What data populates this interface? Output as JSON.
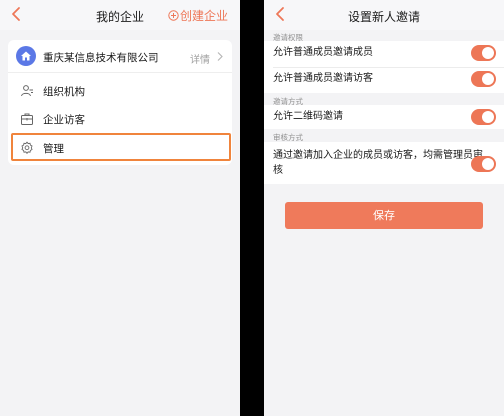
{
  "colors": {
    "accent": "#ee7758",
    "toggle_on": "#ed7656",
    "highlight_border": "#f0843c",
    "avatar": "#5b78e6"
  },
  "left_screen": {
    "nav": {
      "back_icon": "chevron-left-icon",
      "title": "我的企业",
      "action_icon": "plus-circle-icon",
      "action_label": "创建企业"
    },
    "company": {
      "avatar_icon": "home-icon",
      "name": "重庆某信息技术有限公司",
      "detail_label": "详情",
      "chevron_icon": "chevron-right-icon"
    },
    "menu": [
      {
        "icon": "org-structure-icon",
        "label": "组织机构"
      },
      {
        "icon": "visitor-briefcase-icon",
        "label": "企业访客"
      },
      {
        "icon": "gear-icon",
        "label": "管理",
        "highlighted": true
      }
    ]
  },
  "right_screen": {
    "nav": {
      "back_icon": "chevron-left-icon",
      "title": "设置新人邀请"
    },
    "sections": [
      {
        "header": "邀请权限",
        "items": [
          {
            "label": "允许普通成员邀请成员",
            "enabled": true
          },
          {
            "label": "允许普通成员邀请访客",
            "enabled": true
          }
        ]
      },
      {
        "header": "邀请方式",
        "items": [
          {
            "label": "允许二维码邀请",
            "enabled": true
          }
        ]
      },
      {
        "header": "审核方式",
        "items": [
          {
            "label_line1": "通过邀请加入企业的成员或访客，均需管理员审",
            "label_line2": "核",
            "enabled": true
          }
        ]
      }
    ],
    "save_label": "保存"
  }
}
